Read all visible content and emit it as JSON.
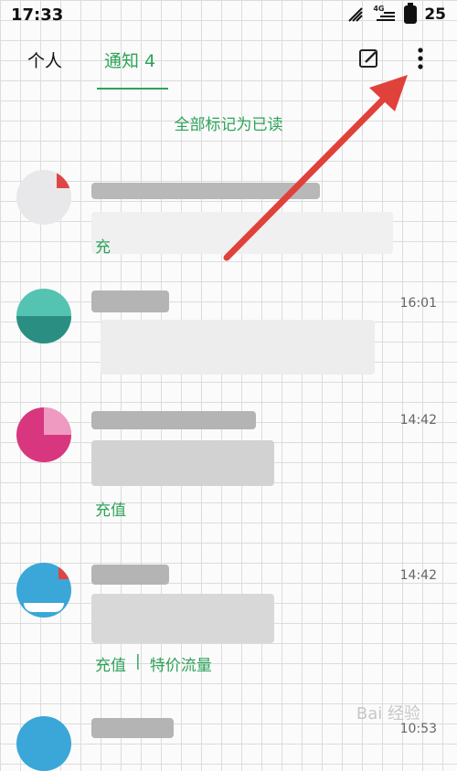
{
  "status_bar": {
    "time": "17:33",
    "network": "4G",
    "battery": "25"
  },
  "nav": {
    "tab_personal": "个人",
    "tab_notifications": "通知 4"
  },
  "mark_all_read": "全部标记为已读",
  "items": [
    {
      "time": "",
      "actions": [
        "充"
      ]
    },
    {
      "time": "16:01",
      "actions": []
    },
    {
      "time": "14:42",
      "actions": [
        "充值"
      ]
    },
    {
      "time": "14:42",
      "actions": [
        "充值",
        "特价流量"
      ],
      "separator": "|"
    },
    {
      "time": "10:53",
      "actions": []
    }
  ],
  "watermark": "Bai 经验",
  "colors": {
    "accent": "#2ea35a",
    "arrow": "#e0413a"
  }
}
